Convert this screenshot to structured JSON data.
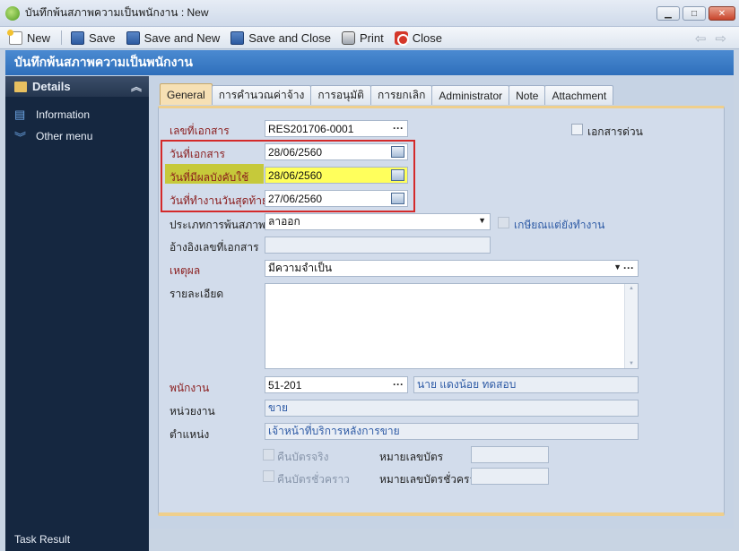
{
  "window": {
    "title": "บันทึกพ้นสภาพความเป็นพนักงาน : New"
  },
  "toolbar": {
    "new_label": "New",
    "save_label": "Save",
    "save_new_label": "Save and New",
    "save_close_label": "Save and Close",
    "print_label": "Print",
    "close_label": "Close"
  },
  "header": {
    "title": "บันทึกพ้นสภาพความเป็นพนักงาน"
  },
  "sidebar": {
    "section": "Details",
    "items": [
      {
        "label": "Information",
        "icon": "info-icon"
      },
      {
        "label": "Other menu",
        "icon": "chevrons-down-icon"
      }
    ],
    "footer": "Task Result"
  },
  "tabs": [
    "General",
    "การคำนวณค่าจ้าง",
    "การอนุมัติ",
    "การยกเลิก",
    "Administrator",
    "Note",
    "Attachment"
  ],
  "form": {
    "doc_no_label": "เลขที่เอกสาร",
    "doc_no": "RES201706-0001",
    "urgent_label": "เอกสารด่วน",
    "doc_date_label": "วันที่เอกสาร",
    "doc_date": "28/06/2560",
    "effective_date_label": "วันที่มีผลบังคับใช้",
    "effective_date": "28/06/2560",
    "last_work_date_label": "วันที่ทำงานวันสุดท้าย",
    "last_work_date": "27/06/2560",
    "resign_type_label": "ประเภทการพ้นสภาพ",
    "resign_type": "ลาออก",
    "retire_working_label": "เกษียณแต่ยังทำงาน",
    "ref_doc_label": "อ้างอิงเลขที่เอกสาร",
    "ref_doc": "",
    "reason_label": "เหตุผล",
    "reason": "มีความจำเป็น",
    "detail_label": "รายละเอียด",
    "detail": "",
    "employee_label": "พนักงาน",
    "employee_code": "51-201",
    "employee_name": "นาย แดงน้อย ทดสอบ",
    "unit_label": "หน่วยงาน",
    "unit": "ขาย",
    "position_label": "ตำแหน่ง",
    "position": "เจ้าหน้าที่บริการหลังการขาย",
    "return_card_label": "คืนบัตรจริง",
    "card_no_label": "หมายเลขบัตร",
    "card_no": "",
    "return_temp_card_label": "คืนบัตรชั่วคราว",
    "temp_card_no_label": "หมายเลขบัตรชั่วคราว",
    "temp_card_no": ""
  },
  "colors": {
    "header_blue": "#3a7cc8",
    "sidebar_bg": "#152740",
    "required_label": "#8a1c1c",
    "highlight_yellow": "#ffff5c",
    "callout_red": "#d42a2a"
  }
}
